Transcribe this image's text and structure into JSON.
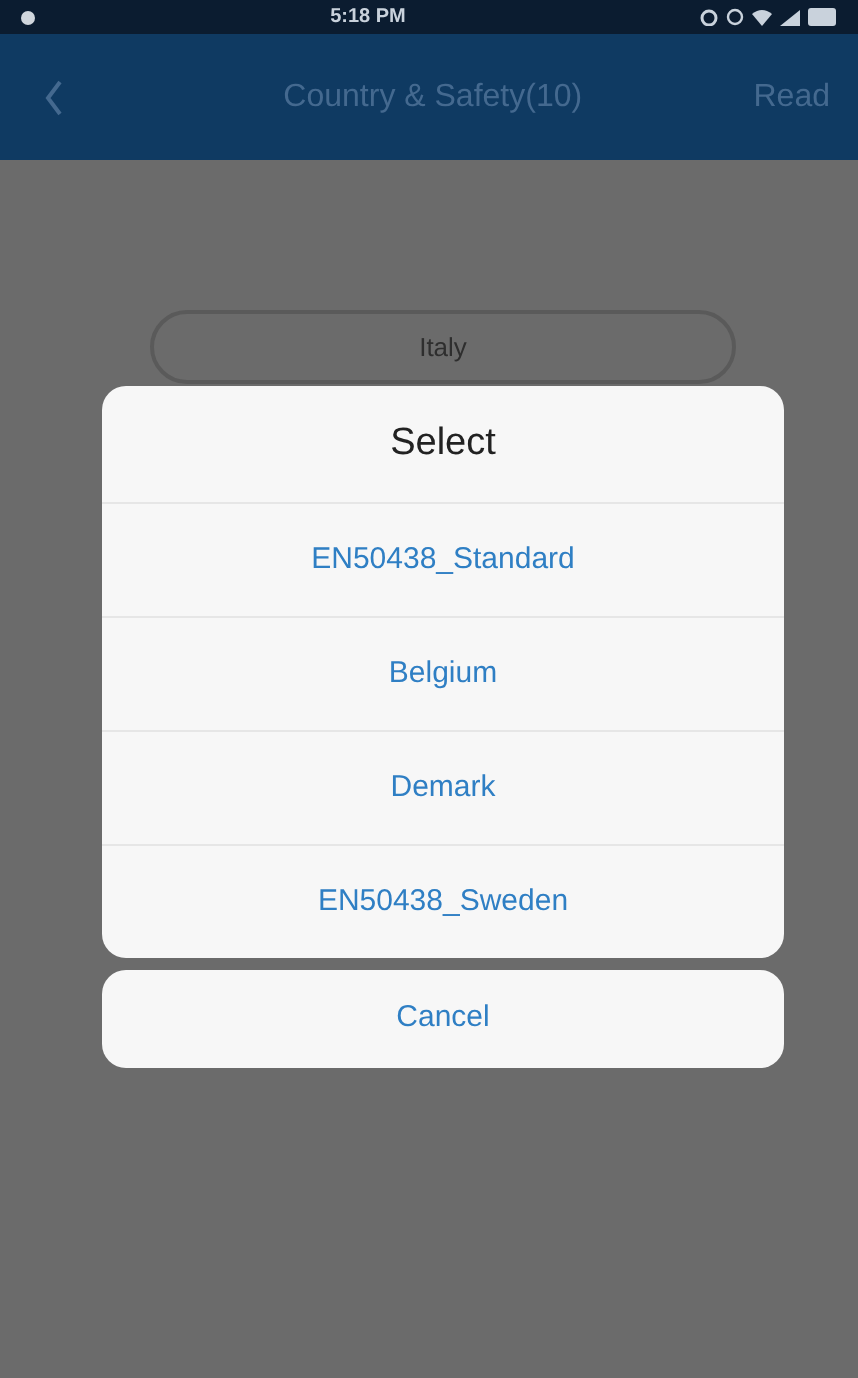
{
  "status_bar": {
    "time": "5:18 PM"
  },
  "nav_bar": {
    "title": "Country & Safety(10)",
    "action": "Read"
  },
  "field": {
    "value": "Italy"
  },
  "dialog": {
    "title": "Select",
    "options": [
      {
        "label": "EN50438_Standard"
      },
      {
        "label": "Belgium"
      },
      {
        "label": "Demark"
      },
      {
        "label": "EN50438_Sweden"
      }
    ],
    "cancel": "Cancel"
  }
}
